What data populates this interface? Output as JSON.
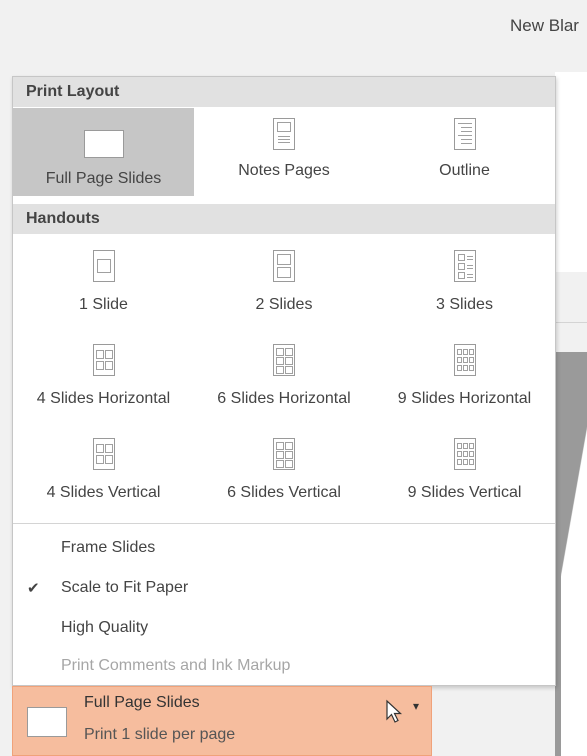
{
  "header": {
    "doc_title": "New Blar"
  },
  "menu": {
    "print_layout_header": "Print Layout",
    "print_layout_items": [
      {
        "label": "Full Page Slides",
        "icon": "full-page-slide-icon",
        "selected": true
      },
      {
        "label": "Notes Pages",
        "icon": "notes-pages-icon",
        "selected": false
      },
      {
        "label": "Outline",
        "icon": "outline-icon",
        "selected": false
      }
    ],
    "handouts_header": "Handouts",
    "handouts_items": [
      {
        "label": "1 Slide",
        "icon": "handout-1-slide-icon"
      },
      {
        "label": "2 Slides",
        "icon": "handout-2-slides-icon"
      },
      {
        "label": "3 Slides",
        "icon": "handout-3-slides-icon"
      },
      {
        "label": "4 Slides Horizontal",
        "icon": "handout-4-horizontal-icon"
      },
      {
        "label": "6 Slides Horizontal",
        "icon": "handout-6-horizontal-icon"
      },
      {
        "label": "9 Slides Horizontal",
        "icon": "handout-9-horizontal-icon"
      },
      {
        "label": "4 Slides Vertical",
        "icon": "handout-4-vertical-icon"
      },
      {
        "label": "6 Slides Vertical",
        "icon": "handout-6-vertical-icon"
      },
      {
        "label": "9 Slides Vertical",
        "icon": "handout-9-vertical-icon"
      }
    ],
    "options": [
      {
        "label": "Frame Slides",
        "checked": false,
        "disabled": false
      },
      {
        "label": "Scale to Fit Paper",
        "checked": true,
        "disabled": false
      },
      {
        "label": "High Quality",
        "checked": false,
        "disabled": false
      },
      {
        "label": "Print Comments and Ink Markup",
        "checked": false,
        "disabled": true
      }
    ]
  },
  "selector": {
    "title": "Full Page Slides",
    "subtitle": "Print 1 slide per page",
    "check_glyph": "✔",
    "arrow_glyph": "▾"
  },
  "colors": {
    "selected_bg": "#c6c6c6",
    "selector_bg": "#f6bd9e",
    "header_bg": "#e1e1e1"
  }
}
